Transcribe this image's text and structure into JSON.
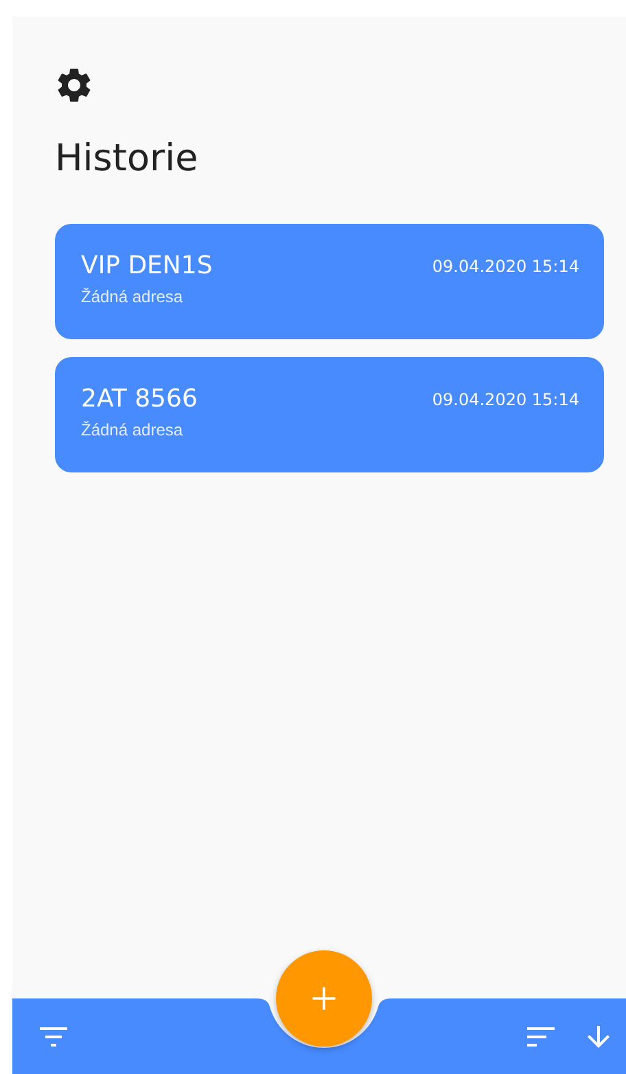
{
  "header": {
    "title": "Historie"
  },
  "history": [
    {
      "plate": "VIP DEN1S",
      "datetime": "09.04.2020 15:14",
      "address": "Žádná adresa"
    },
    {
      "plate": "2AT 8566",
      "datetime": "09.04.2020 15:14",
      "address": "Žádná adresa"
    }
  ]
}
